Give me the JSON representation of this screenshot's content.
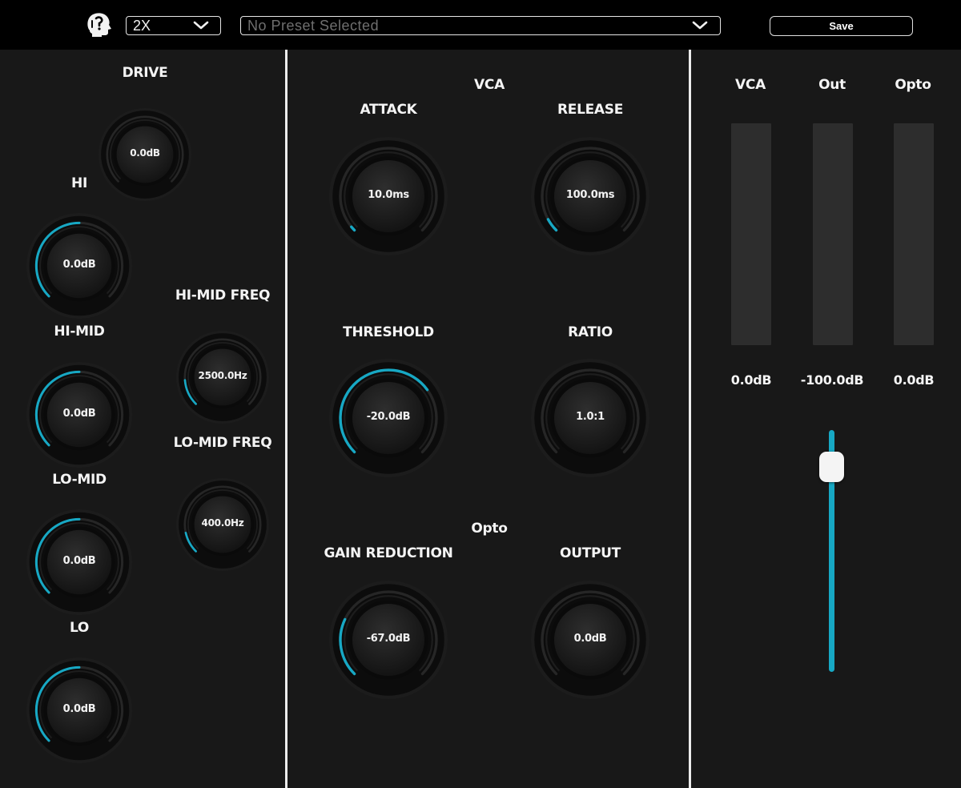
{
  "toolbar": {
    "logo_icon": "head-profile-icon",
    "oversample": {
      "value": "2X"
    },
    "preset": {
      "value": "No Preset Selected"
    },
    "save_label": "Save"
  },
  "eq_section": {
    "drive_label": "DRIVE",
    "hi_label": "HI",
    "hi_mid_label": "HI-MID",
    "lo_mid_label": "LO-MID",
    "lo_label": "LO",
    "hi_mid_freq_label": "HI-MID FREQ",
    "lo_mid_freq_label": "LO-MID FREQ",
    "knobs": {
      "drive": {
        "value": "0.0dB",
        "level": 0
      },
      "hi": {
        "value": "0.0dB",
        "level": 0.5
      },
      "hi_mid": {
        "value": "0.0dB",
        "level": 0.5
      },
      "lo_mid": {
        "value": "0.0dB",
        "level": 0.5
      },
      "lo": {
        "value": "0.0dB",
        "level": 0.5
      },
      "hi_mid_freq": {
        "value": "2500.0Hz",
        "level": 0.15
      },
      "lo_mid_freq": {
        "value": "400.0Hz",
        "level": 0.12
      }
    }
  },
  "comp_section": {
    "vca_label": "VCA",
    "opto_label": "Opto",
    "attack_label": "ATTACK",
    "release_label": "RELEASE",
    "threshold_label": "THRESHOLD",
    "ratio_label": "RATIO",
    "gain_reduction_label": "GAIN REDUCTION",
    "output_label": "OUTPUT",
    "knobs": {
      "attack": {
        "value": "10.0ms",
        "level": 0.02
      },
      "release": {
        "value": "100.0ms",
        "level": 0.06
      },
      "threshold": {
        "value": "-20.0dB",
        "level": 0.7
      },
      "ratio": {
        "value": "1.0:1",
        "level": 0
      },
      "gain_reduction": {
        "value": "-67.0dB",
        "level": 0.26
      },
      "output": {
        "value": "0.0dB",
        "level": 0
      }
    }
  },
  "meters": {
    "vca": {
      "label": "VCA",
      "value": "0.0dB",
      "level": 0
    },
    "out": {
      "label": "Out",
      "value": "-100.0dB",
      "level": 0
    },
    "opto": {
      "label": "Opto",
      "value": "0.0dB",
      "level": 0
    }
  },
  "output_fader": {
    "level": 0.9
  },
  "colors": {
    "accent": "#17a8c4",
    "background": "#181818",
    "toolbar": "#000000",
    "meter": "#2d2d2d"
  }
}
